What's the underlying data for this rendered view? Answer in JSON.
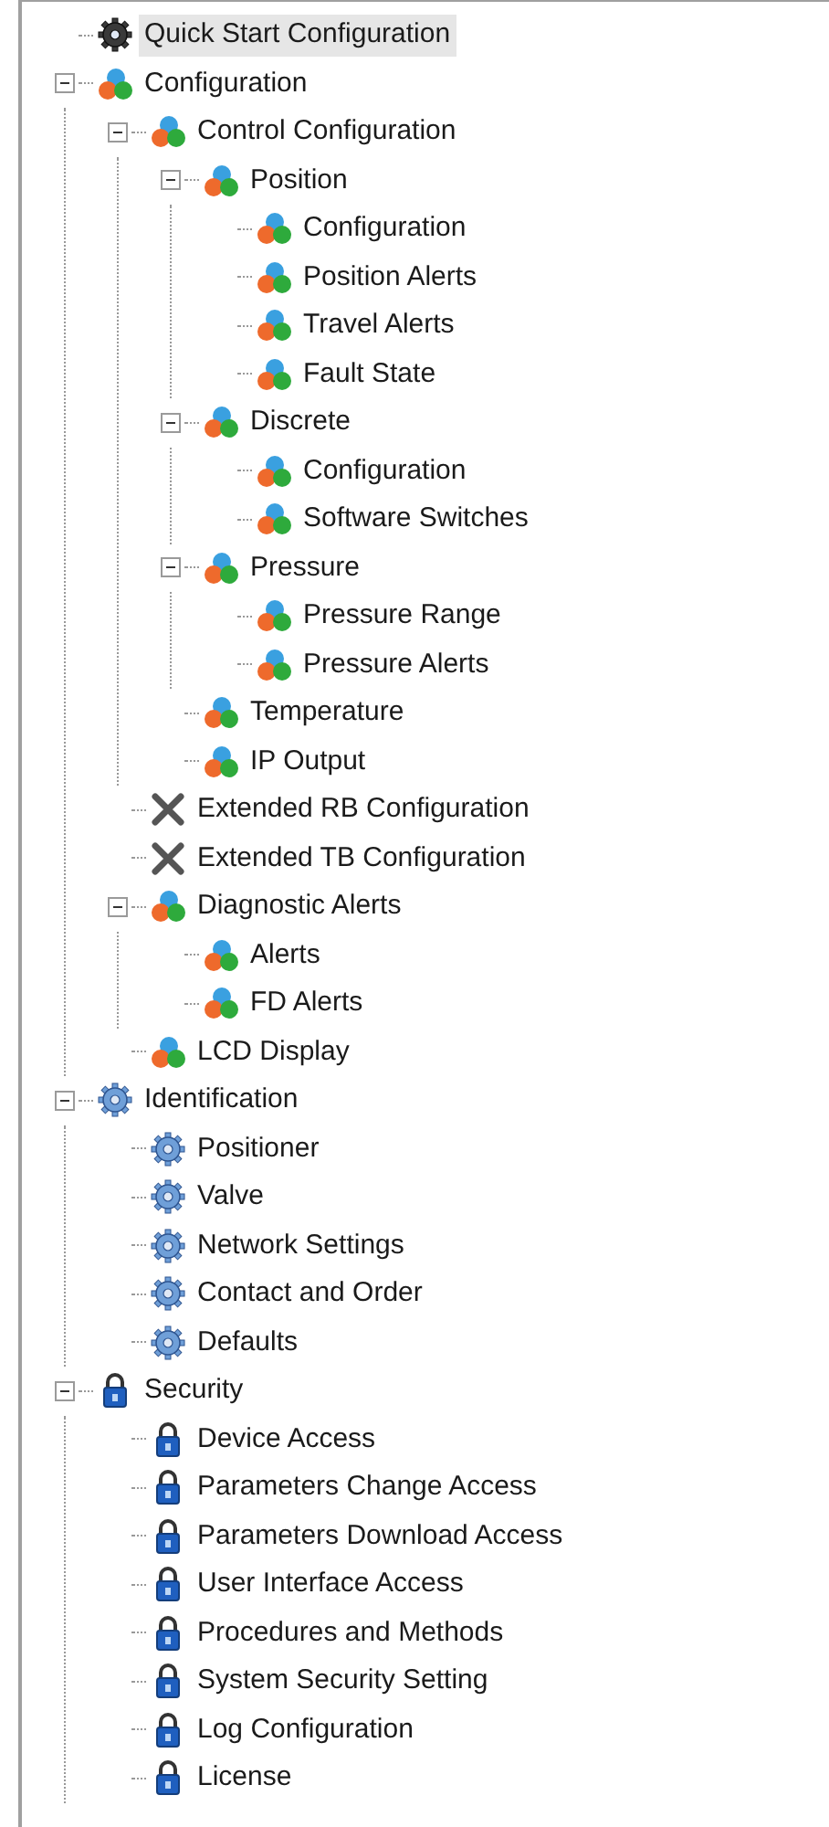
{
  "tree": [
    {
      "label": "Quick Start Configuration",
      "kind": "gear",
      "selected": true
    },
    {
      "label": "Configuration",
      "kind": "blocks",
      "selected": false,
      "expanded": true,
      "children": [
        {
          "label": "Control Configuration",
          "kind": "blocks",
          "selected": false,
          "expanded": true,
          "children": [
            {
              "label": "Position",
              "kind": "blocks",
              "selected": false,
              "expanded": true,
              "children": [
                {
                  "label": "Configuration",
                  "kind": "blocks",
                  "selected": false
                },
                {
                  "label": "Position Alerts",
                  "kind": "blocks",
                  "selected": false
                },
                {
                  "label": "Travel Alerts",
                  "kind": "blocks",
                  "selected": false
                },
                {
                  "label": "Fault State",
                  "kind": "blocks",
                  "selected": false
                }
              ]
            },
            {
              "label": "Discrete",
              "kind": "blocks",
              "selected": false,
              "expanded": true,
              "children": [
                {
                  "label": "Configuration",
                  "kind": "blocks",
                  "selected": false
                },
                {
                  "label": "Software Switches",
                  "kind": "blocks",
                  "selected": false
                }
              ]
            },
            {
              "label": "Pressure",
              "kind": "blocks",
              "selected": false,
              "expanded": true,
              "children": [
                {
                  "label": "Pressure Range",
                  "kind": "blocks",
                  "selected": false
                },
                {
                  "label": "Pressure Alerts",
                  "kind": "blocks",
                  "selected": false
                }
              ]
            },
            {
              "label": "Temperature",
              "kind": "blocks",
              "selected": false
            },
            {
              "label": "IP Output",
              "kind": "blocks",
              "selected": false
            }
          ]
        },
        {
          "label": "Extended RB Configuration",
          "kind": "tools",
          "selected": false
        },
        {
          "label": "Extended TB Configuration",
          "kind": "tools",
          "selected": false
        },
        {
          "label": "Diagnostic Alerts",
          "kind": "blocks",
          "selected": false,
          "expanded": true,
          "children": [
            {
              "label": "Alerts",
              "kind": "blocks",
              "selected": false
            },
            {
              "label": "FD Alerts",
              "kind": "blocks",
              "selected": false
            }
          ]
        },
        {
          "label": "LCD Display",
          "kind": "blocks",
          "selected": false
        }
      ]
    },
    {
      "label": "Identification",
      "kind": "cog",
      "selected": false,
      "expanded": true,
      "children": [
        {
          "label": "Positioner",
          "kind": "cog",
          "selected": false
        },
        {
          "label": "Valve",
          "kind": "cog",
          "selected": false
        },
        {
          "label": "Network Settings",
          "kind": "cog",
          "selected": false
        },
        {
          "label": "Contact and Order",
          "kind": "cog",
          "selected": false
        },
        {
          "label": "Defaults",
          "kind": "cog",
          "selected": false
        }
      ]
    },
    {
      "label": "Security",
      "kind": "lock",
      "selected": false,
      "expanded": true,
      "children": [
        {
          "label": "Device Access",
          "kind": "lock",
          "selected": false
        },
        {
          "label": "Parameters Change Access",
          "kind": "lock",
          "selected": false
        },
        {
          "label": "Parameters Download Access",
          "kind": "lock",
          "selected": false
        },
        {
          "label": "User Interface Access",
          "kind": "lock",
          "selected": false
        },
        {
          "label": "Procedures and Methods",
          "kind": "lock",
          "selected": false
        },
        {
          "label": "System Security Setting",
          "kind": "lock",
          "selected": false
        },
        {
          "label": "Log Configuration",
          "kind": "lock",
          "selected": false
        },
        {
          "label": "License",
          "kind": "lock",
          "selected": false
        }
      ]
    }
  ]
}
